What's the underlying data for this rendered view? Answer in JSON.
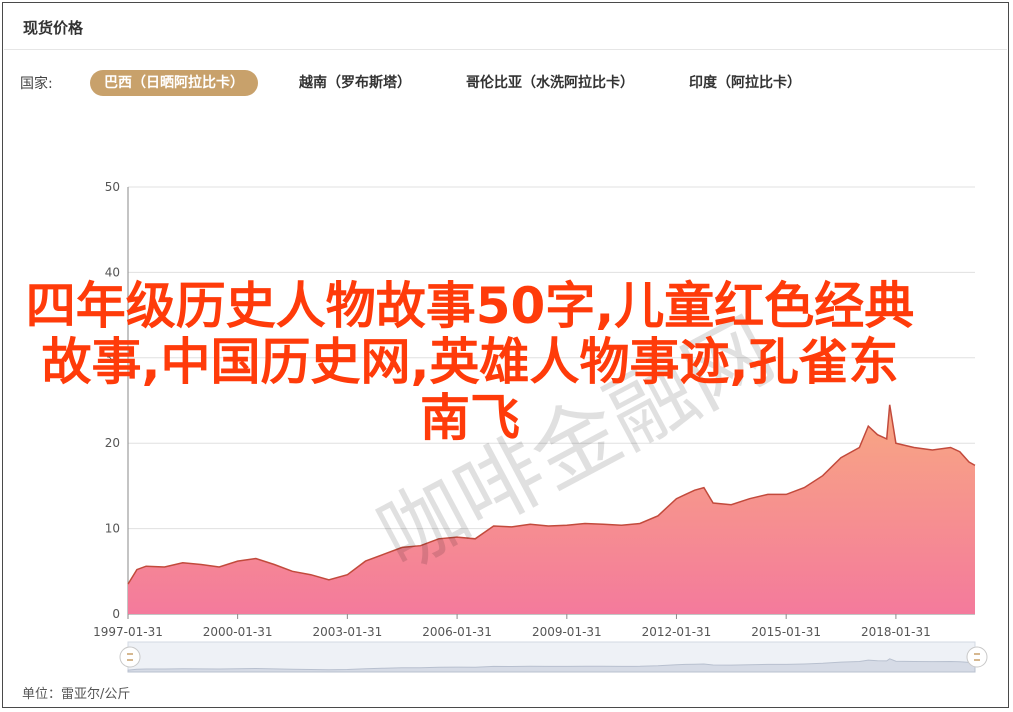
{
  "panel": {
    "title": "现货价格",
    "country_label": "国家:",
    "countries": [
      {
        "label": "巴西（日晒阿拉比卡）",
        "active": true
      },
      {
        "label": "越南（罗布斯塔）",
        "active": false
      },
      {
        "label": "哥伦比亚（水洗阿拉比卡）",
        "active": false
      },
      {
        "label": "印度（阿拉比卡）",
        "active": false
      }
    ],
    "unit_text": "单位：雷亚尔/公斤"
  },
  "overlay": {
    "headline": "四年级历史人物故事50字,儿童红色经典故事,中国历史网,英雄人物事迹,孔雀东南飞",
    "watermark": "咖啡金融网"
  },
  "colors": {
    "accent": "#c8a16b",
    "area_top": "#f8a882",
    "area_bottom": "#f47a9c",
    "line": "#c24a3c",
    "headline": "#ff3b0a"
  },
  "chart_data": {
    "type": "area",
    "title": "",
    "xlabel": "",
    "ylabel": "",
    "ylim": [
      0,
      50
    ],
    "yticks": [
      0,
      10,
      20,
      30,
      40,
      50
    ],
    "xticks": [
      "1997-01-31",
      "2000-01-31",
      "2003-01-31",
      "2006-01-31",
      "2009-01-31",
      "2012-01-31",
      "2015-01-31",
      "2018-01-31"
    ],
    "x_start": "1997-01-31",
    "x_end": "2020-03-31",
    "grid": true,
    "legend": "none",
    "series": [
      {
        "x": [
          "1997-01-31",
          "1997-04-30",
          "1997-07-31",
          "1998-01-31",
          "1998-07-31",
          "1999-01-31",
          "1999-07-31",
          "2000-01-31",
          "2000-07-31",
          "2001-01-31",
          "2001-07-31",
          "2002-01-31",
          "2002-07-31",
          "2003-01-31",
          "2003-07-31",
          "2004-01-31",
          "2004-07-31",
          "2005-01-31",
          "2005-07-31",
          "2006-01-31",
          "2006-07-31",
          "2007-01-31",
          "2007-07-31",
          "2008-01-31",
          "2008-07-31",
          "2009-01-31",
          "2009-07-31",
          "2010-01-31",
          "2010-07-31",
          "2011-01-31",
          "2011-07-31",
          "2012-01-31",
          "2012-04-30",
          "2012-07-31",
          "2012-10-31",
          "2013-01-31",
          "2013-07-31",
          "2014-01-31",
          "2014-07-31",
          "2015-01-31",
          "2015-07-31",
          "2016-01-31",
          "2016-07-31",
          "2017-01-31",
          "2017-04-30",
          "2017-07-31",
          "2017-10-31",
          "2017-11-30",
          "2018-01-31",
          "2018-07-31",
          "2019-01-31",
          "2019-07-31",
          "2019-10-31",
          "2020-01-31",
          "2020-03-31"
        ],
        "values": [
          3.5,
          5.2,
          5.6,
          5.5,
          6.0,
          5.8,
          5.5,
          6.2,
          6.5,
          5.8,
          5.0,
          4.6,
          4.0,
          4.6,
          6.2,
          7.0,
          7.8,
          8.0,
          8.8,
          9.0,
          8.8,
          10.3,
          10.2,
          10.5,
          10.3,
          10.4,
          10.6,
          10.5,
          10.4,
          10.6,
          11.5,
          13.5,
          14.0,
          14.5,
          14.8,
          13.0,
          12.8,
          13.5,
          14.0,
          14.0,
          14.8,
          16.2,
          18.3,
          19.5,
          22.0,
          21.0,
          20.5,
          24.5,
          20.0,
          19.5,
          19.2,
          19.5,
          19.0,
          17.8,
          17.4
        ]
      }
    ]
  }
}
